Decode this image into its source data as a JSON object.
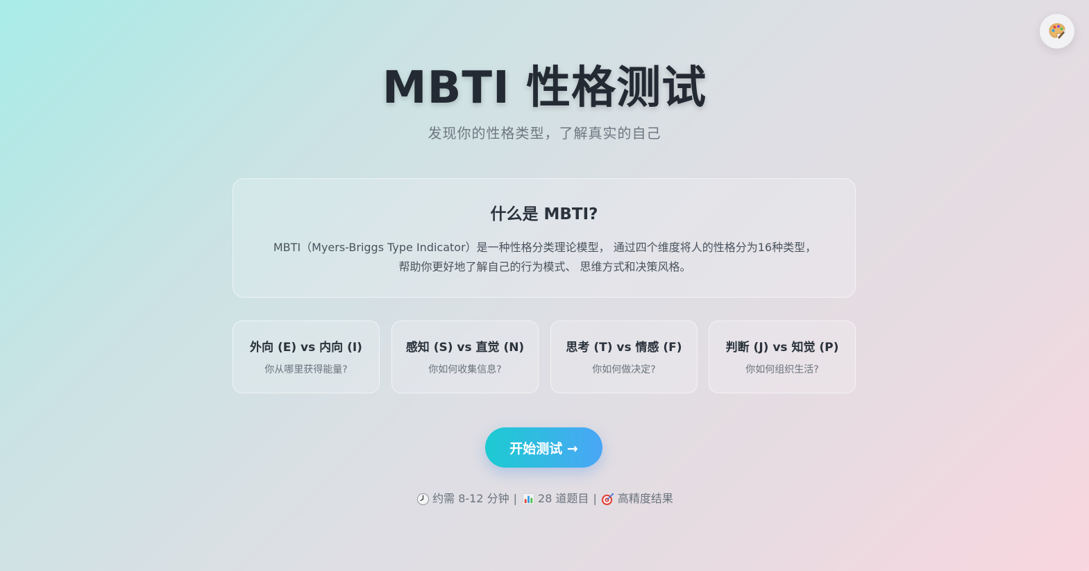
{
  "theme_button": {
    "icon": "palette-icon"
  },
  "header": {
    "title": "MBTI 性格测试",
    "subtitle": "发现你的性格类型，了解真实的自己"
  },
  "intro": {
    "heading": "什么是 MBTI?",
    "line1": "MBTI（Myers-Briggs Type Indicator）是一种性格分类理论模型， 通过四个维度将人的性格分为16种类型，",
    "line2": "帮助你更好地了解自己的行为模式、 思维方式和决策风格。"
  },
  "dimensions": [
    {
      "title": "外向 (E) vs 内向 (I)",
      "question": "你从哪里获得能量?"
    },
    {
      "title": "感知 (S) vs 直觉 (N)",
      "question": "你如何收集信息?"
    },
    {
      "title": "思考 (T) vs 情感 (F)",
      "question": "你如何做决定?"
    },
    {
      "title": "判断 (J) vs 知觉 (P)",
      "question": "你如何组织生活?"
    }
  ],
  "start_button": {
    "label": "开始测试 →"
  },
  "meta": {
    "time_icon": "clock-icon",
    "time": "约需 8-12 分钟",
    "separator": "|",
    "questions_icon": "bar-chart-icon",
    "questions": "28 道题目",
    "precision_icon": "target-icon",
    "precision": "高精度结果"
  },
  "colors": {
    "button_start": "#1ccbd1",
    "button_end": "#4aa6f6",
    "title": "#232a33"
  }
}
